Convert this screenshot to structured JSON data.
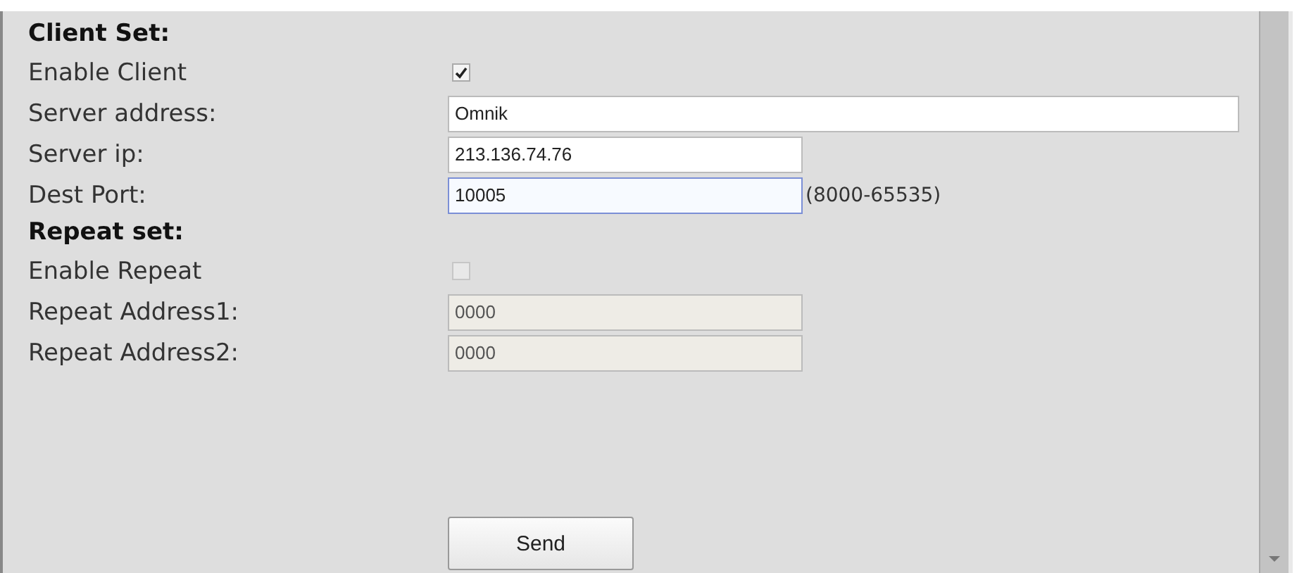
{
  "sections": [
    {
      "title": "Client Set:",
      "rows": [
        {
          "kind": "checkbox",
          "label": "Enable Client",
          "checked": true,
          "disabled": false
        },
        {
          "kind": "text",
          "label": "Server address:",
          "value": "Omnik",
          "wide": true,
          "disabled": false,
          "focused": false
        },
        {
          "kind": "text",
          "label": "Server ip:",
          "value": "213.136.74.76",
          "wide": false,
          "disabled": false,
          "focused": false
        },
        {
          "kind": "text",
          "label": "Dest Port:",
          "value": "10005",
          "wide": false,
          "disabled": false,
          "focused": true,
          "hint": "(8000-65535)"
        }
      ]
    },
    {
      "title": "Repeat set:",
      "rows": [
        {
          "kind": "checkbox",
          "label": "Enable Repeat",
          "checked": false,
          "disabled": true
        },
        {
          "kind": "text",
          "label": "Repeat Address1:",
          "value": "0000",
          "wide": false,
          "disabled": true,
          "focused": false
        },
        {
          "kind": "text",
          "label": "Repeat Address2:",
          "value": "0000",
          "wide": false,
          "disabled": true,
          "focused": false
        }
      ]
    }
  ],
  "button": "Send"
}
